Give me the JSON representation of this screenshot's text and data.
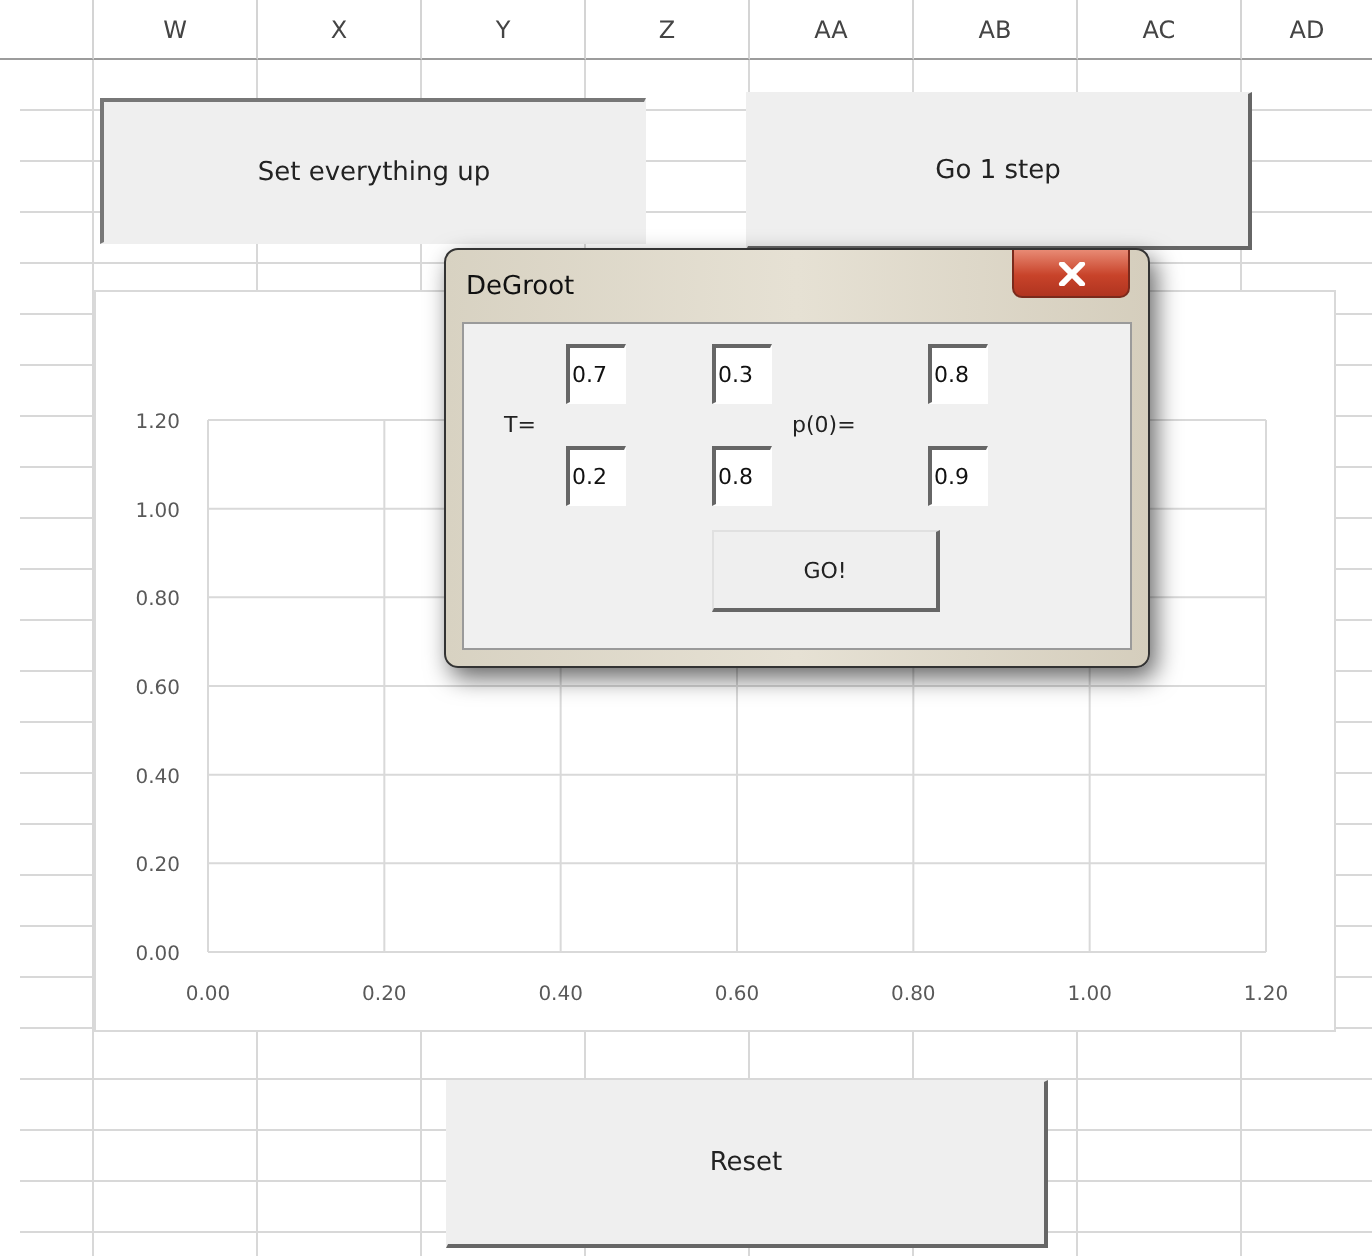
{
  "sheet": {
    "columns": [
      "W",
      "X",
      "Y",
      "Z",
      "AA",
      "AB",
      "AC",
      "AD"
    ]
  },
  "buttons": [
    {
      "label": "Set everything up"
    },
    {
      "label": "Go 1 step"
    },
    {
      "label": "Reset"
    }
  ],
  "chart": {
    "chart_data": {
      "type": "scatter",
      "grid": true,
      "xlim": [
        0,
        1.2
      ],
      "ylim": [
        0,
        1.2
      ],
      "xticks": [
        {
          "value": 0,
          "label": "0.00"
        },
        {
          "value": 0.2,
          "label": "0.20"
        },
        {
          "value": 0.4,
          "label": "0.40"
        },
        {
          "value": 0.6,
          "label": "0.60"
        },
        {
          "value": 0.8,
          "label": "0.80"
        },
        {
          "value": 1,
          "label": "1.00"
        },
        {
          "value": 1.2,
          "label": "1.20"
        }
      ],
      "yticks": [
        {
          "value": 0,
          "label": "0.00"
        },
        {
          "value": 0.2,
          "label": "0.20"
        },
        {
          "value": 0.4,
          "label": "0.40"
        },
        {
          "value": 0.6,
          "label": "0.60"
        },
        {
          "value": 0.8,
          "label": "0.80"
        },
        {
          "value": 1,
          "label": "1.00"
        },
        {
          "value": 1.2,
          "label": "1.20"
        }
      ]
    }
  },
  "dialog": {
    "title": "DeGroot",
    "t_label": "T=",
    "t_values": [
      [
        "0.7",
        "0.3"
      ],
      [
        "0.2",
        "0.8"
      ]
    ],
    "p_label": "p(0)=",
    "p_values": [
      "0.8",
      "0.9"
    ],
    "go_button": "GO!"
  }
}
